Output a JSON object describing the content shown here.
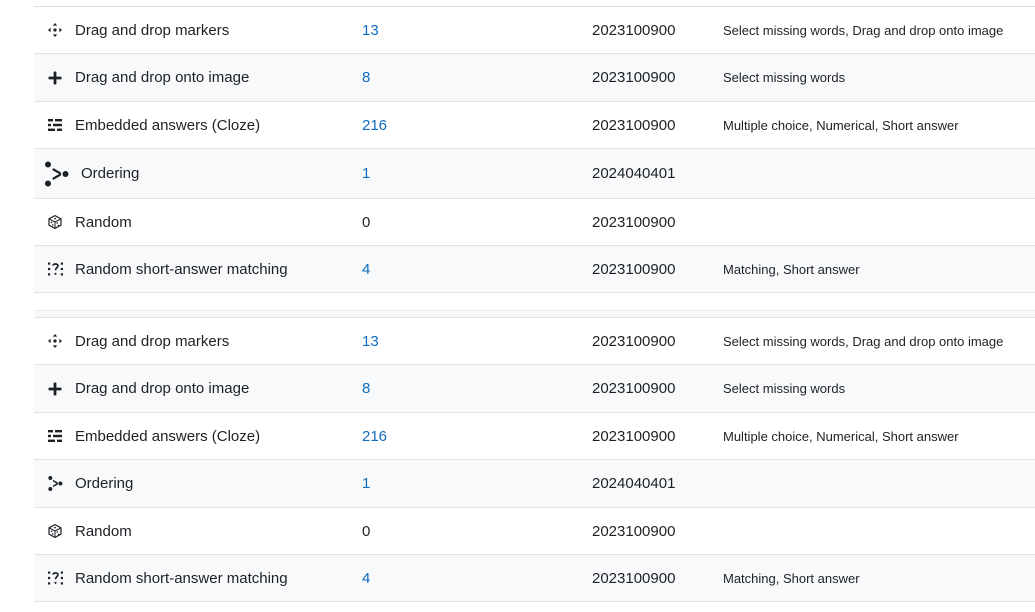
{
  "tables": [
    {
      "rows": [
        {
          "icon": "drag-drop-markers-icon",
          "name": "Drag and drop markers",
          "count": "13",
          "count_link": true,
          "version": "2023100900",
          "requires": "Select missing words, Drag and drop onto image"
        },
        {
          "icon": "drag-drop-onto-image-icon",
          "name": "Drag and drop onto image",
          "count": "8",
          "count_link": true,
          "version": "2023100900",
          "requires": "Select missing words"
        },
        {
          "icon": "embedded-answers-icon",
          "name": "Embedded answers (Cloze)",
          "count": "216",
          "count_link": true,
          "version": "2023100900",
          "requires": "Multiple choice, Numerical, Short answer"
        },
        {
          "icon": "ordering-icon",
          "name": "Ordering",
          "count": "1",
          "count_link": true,
          "version": "2024040401",
          "requires": ""
        },
        {
          "icon": "random-icon",
          "name": "Random",
          "count": "0",
          "count_link": false,
          "version": "2023100900",
          "requires": ""
        },
        {
          "icon": "random-short-answer-matching-icon",
          "name": "Random short-answer matching",
          "count": "4",
          "count_link": true,
          "version": "2023100900",
          "requires": "Matching, Short answer"
        }
      ]
    },
    {
      "rows": [
        {
          "icon": "drag-drop-markers-icon",
          "name": "Drag and drop markers",
          "count": "13",
          "count_link": true,
          "version": "2023100900",
          "requires": "Select missing words, Drag and drop onto image"
        },
        {
          "icon": "drag-drop-onto-image-icon",
          "name": "Drag and drop onto image",
          "count": "8",
          "count_link": true,
          "version": "2023100900",
          "requires": "Select missing words"
        },
        {
          "icon": "embedded-answers-icon",
          "name": "Embedded answers (Cloze)",
          "count": "216",
          "count_link": true,
          "version": "2023100900",
          "requires": "Multiple choice, Numerical, Short answer"
        },
        {
          "icon": "ordering-icon",
          "name": "Ordering",
          "count": "1",
          "count_link": true,
          "version": "2024040401",
          "requires": ""
        },
        {
          "icon": "random-icon",
          "name": "Random",
          "count": "0",
          "count_link": false,
          "version": "2023100900",
          "requires": ""
        },
        {
          "icon": "random-short-answer-matching-icon",
          "name": "Random short-answer matching",
          "count": "4",
          "count_link": true,
          "version": "2023100900",
          "requires": "Matching, Short answer"
        }
      ]
    }
  ],
  "colors": {
    "link": "#0f6cbf",
    "text": "#1d2125",
    "stripe": "#f8f9fa",
    "border": "#dee2e6"
  }
}
